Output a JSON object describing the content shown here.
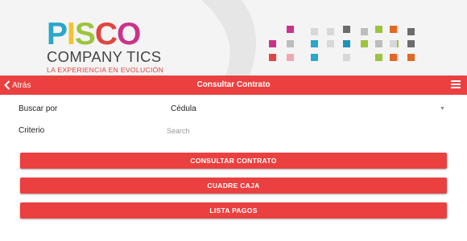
{
  "brand": {
    "letters": [
      {
        "char": "P",
        "color": "#2aa7c9"
      },
      {
        "char": "I",
        "color": "#f1c232"
      },
      {
        "char": "S",
        "color": "#9bc53d"
      },
      {
        "char": "C",
        "color": "#e0453e"
      },
      {
        "char": "O",
        "color": "#c9348a"
      }
    ],
    "subtitle": "COMPANY TICS",
    "tagline": "LA EXPERIENCIA EN EVOLUCIÓN"
  },
  "navbar": {
    "back_label": "Atrás",
    "title": "Consultar Contrato",
    "background": "#ea4040"
  },
  "form": {
    "search_by_label": "Buscar por",
    "search_by_value": "Cédula",
    "criteria_label": "Criterio",
    "criteria_placeholder": "Search",
    "criteria_value": ""
  },
  "buttons": {
    "consult_contract": "CONSULTAR CONTRATO",
    "cash_balance": "CUADRE CAJA",
    "payments_list": "LISTA PAGOS"
  },
  "icons": {
    "back": "chevron-left-icon",
    "menu": "hamburger-menu-icon",
    "dropdown": "caret-down-icon"
  }
}
